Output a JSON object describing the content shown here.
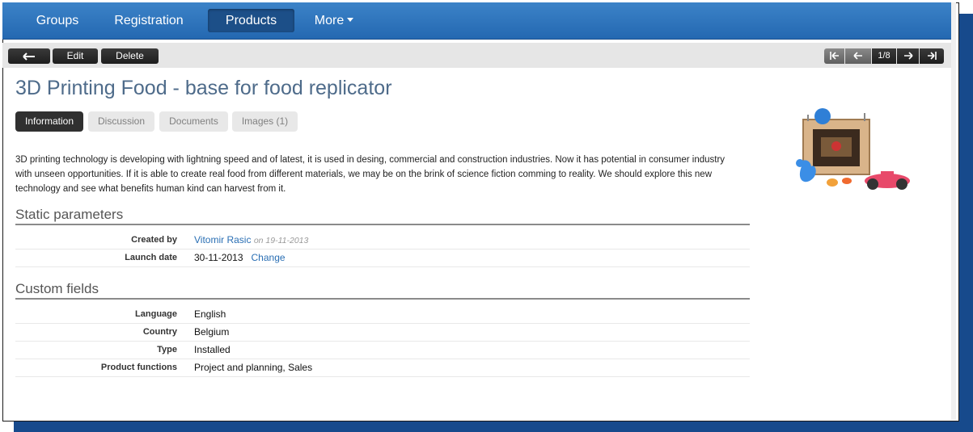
{
  "nav": {
    "items": [
      {
        "label": "Groups"
      },
      {
        "label": "Registration"
      },
      {
        "label": "Products"
      },
      {
        "label": "More"
      }
    ]
  },
  "toolbar": {
    "edit_label": "Edit",
    "delete_label": "Delete",
    "pager": "1/8"
  },
  "product": {
    "title": "3D Printing Food - base for food replicator",
    "description": "3D printing technology is developing with lightning speed and of latest, it is used in desing, commercial and construction industries. Now it has potential in consumer industry with unseen opportunities. If it is able to create real food from different materials, we may be on the brink of science fiction comming to reality. We should explore this new technology and see what benefits human kind can harvest from it."
  },
  "tabs": [
    "Information",
    "Discussion",
    "Documents",
    "Images (1)"
  ],
  "static": {
    "heading": "Static parameters",
    "created_by_label": "Created by",
    "created_by_name": "Vitomir Rasic",
    "created_on": "on 19-11-2013",
    "launch_label": "Launch date",
    "launch_value": "30-11-2013",
    "change_link": "Change"
  },
  "custom": {
    "heading": "Custom fields",
    "rows": [
      {
        "label": "Language",
        "value": "English"
      },
      {
        "label": "Country",
        "value": "Belgium"
      },
      {
        "label": "Type",
        "value": "Installed"
      },
      {
        "label": "Product functions",
        "value": "Project and planning, Sales"
      }
    ]
  }
}
